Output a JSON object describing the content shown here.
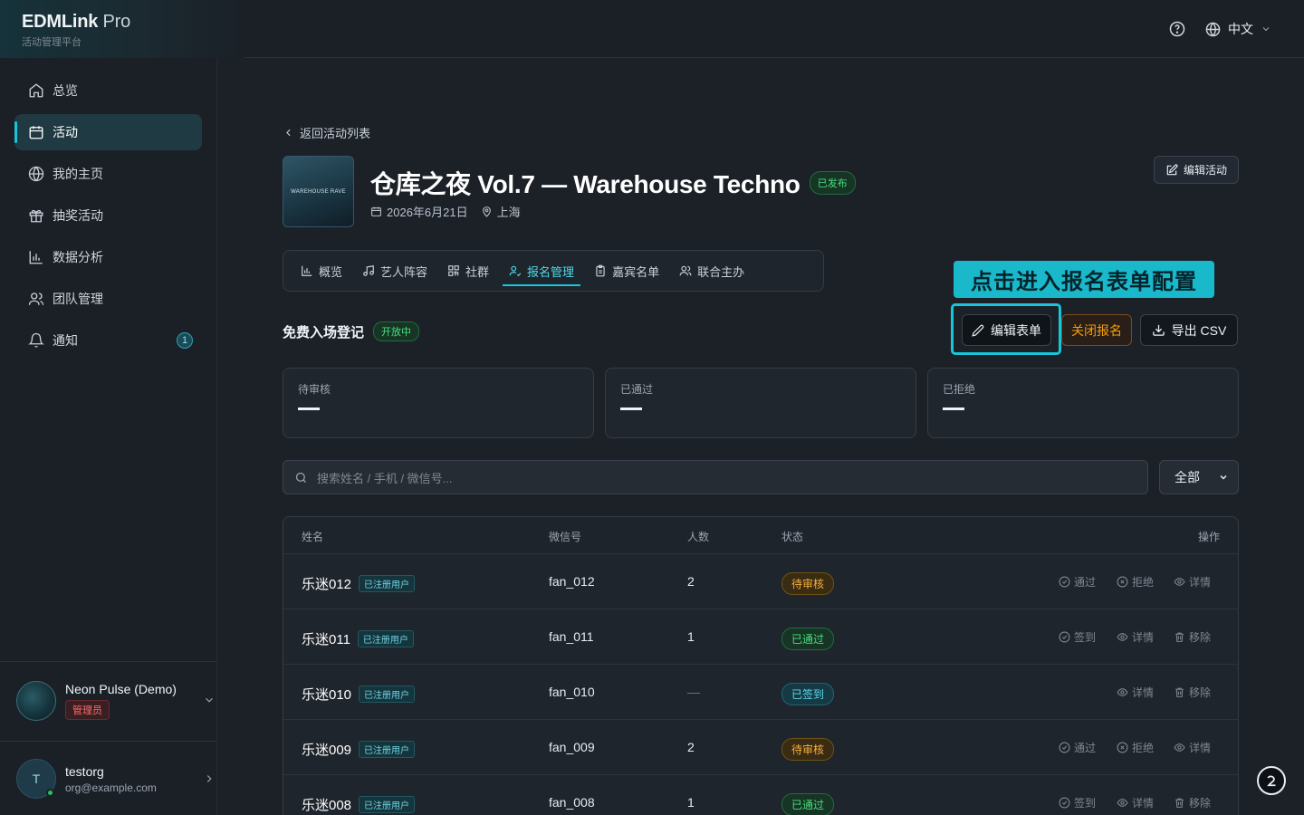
{
  "brand": {
    "title": "EDMLink",
    "title_suffix": "Pro",
    "subtitle": "活动管理平台"
  },
  "topbar": {
    "language": "中文",
    "help_icon": "help-circle-icon",
    "globe_icon": "globe-icon"
  },
  "sidebar": {
    "items": [
      {
        "label": "总览",
        "icon": "home-icon"
      },
      {
        "label": "活动",
        "icon": "calendar-icon",
        "active": true
      },
      {
        "label": "我的主页",
        "icon": "globe-icon"
      },
      {
        "label": "抽奖活动",
        "icon": "gift-icon"
      },
      {
        "label": "数据分析",
        "icon": "bar-chart-icon"
      },
      {
        "label": "团队管理",
        "icon": "users-icon"
      },
      {
        "label": "通知",
        "icon": "bell-icon",
        "badge": "1"
      }
    ],
    "account_org": {
      "name": "Neon Pulse (Demo)",
      "role": "管理员"
    },
    "account_user": {
      "initial": "T",
      "name": "testorg",
      "email": "org@example.com"
    }
  },
  "main": {
    "back_label": "返回活动列表",
    "event": {
      "cover_text": "WAREHOUSE RAVE",
      "title": "仓库之夜 Vol.7 — Warehouse Techno",
      "status": "已发布",
      "date": "2026年6月21日",
      "location": "上海",
      "edit_label": "编辑活动"
    },
    "tabs": [
      {
        "label": "概览",
        "icon": "bar-chart-icon"
      },
      {
        "label": "艺人阵容",
        "icon": "music-icon"
      },
      {
        "label": "社群",
        "icon": "qr-code-icon"
      },
      {
        "label": "报名管理",
        "icon": "user-check-icon",
        "active": true
      },
      {
        "label": "嘉宾名单",
        "icon": "clipboard-icon"
      },
      {
        "label": "联合主办",
        "icon": "users-icon"
      }
    ],
    "callout": "点击进入报名表单配置",
    "section": {
      "title": "免费入场登记",
      "status": "开放中"
    },
    "actions": {
      "edit_form": "编辑表单",
      "close_registration": "关闭报名",
      "export_csv": "导出 CSV"
    },
    "stats": [
      {
        "label": "待审核",
        "value": "—"
      },
      {
        "label": "已通过",
        "value": "—"
      },
      {
        "label": "已拒绝",
        "value": "—"
      }
    ],
    "search": {
      "placeholder": "搜索姓名 / 手机 / 微信号..."
    },
    "filter": {
      "selected": "全部"
    },
    "table": {
      "headers": {
        "name": "姓名",
        "wechat": "微信号",
        "count": "人数",
        "status": "状态",
        "actions": "操作"
      },
      "rows": [
        {
          "name": "乐迷012",
          "tag": "已注册用户",
          "wechat": "fan_012",
          "count": "2",
          "status": "待审核",
          "status_type": "pending",
          "actions": [
            "通过",
            "拒绝",
            "详情"
          ]
        },
        {
          "name": "乐迷011",
          "tag": "已注册用户",
          "wechat": "fan_011",
          "count": "1",
          "status": "已通过",
          "status_type": "passed",
          "actions": [
            "签到",
            "详情",
            "移除"
          ]
        },
        {
          "name": "乐迷010",
          "tag": "已注册用户",
          "wechat": "fan_010",
          "count": "—",
          "status": "已签到",
          "status_type": "checked",
          "actions": [
            "详情",
            "移除"
          ]
        },
        {
          "name": "乐迷009",
          "tag": "已注册用户",
          "wechat": "fan_009",
          "count": "2",
          "status": "待审核",
          "status_type": "pending",
          "actions": [
            "通过",
            "拒绝",
            "详情"
          ]
        },
        {
          "name": "乐迷008",
          "tag": "已注册用户",
          "wechat": "fan_008",
          "count": "1",
          "status": "已通过",
          "status_type": "passed",
          "actions": [
            "签到",
            "详情",
            "移除"
          ]
        }
      ]
    }
  },
  "colors": {
    "accent": "#19c5d8",
    "background": "#1c2128",
    "pending": "#f5b043",
    "passed": "#4ade80",
    "warning": "#f59e0b"
  }
}
